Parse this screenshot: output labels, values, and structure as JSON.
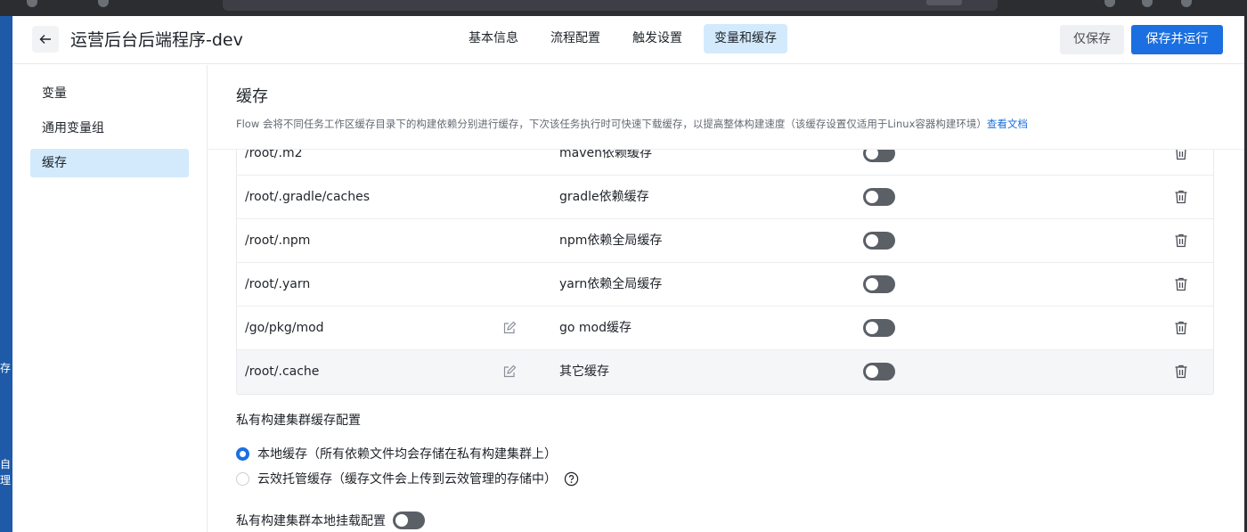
{
  "colors": {
    "accent": "#1b6fe0",
    "active_bg": "#d3eafd",
    "toggle_off": "#5b5f66"
  },
  "desktop": {
    "glyphs": [
      "存",
      "自",
      "理"
    ]
  },
  "header": {
    "title": "运营后台后端程序-dev",
    "tabs": [
      {
        "label": "基本信息",
        "active": false
      },
      {
        "label": "流程配置",
        "active": false
      },
      {
        "label": "触发设置",
        "active": false
      },
      {
        "label": "变量和缓存",
        "active": true
      }
    ],
    "save_only_label": "仅保存",
    "save_run_label": "保存并运行"
  },
  "sidebar": {
    "items": [
      {
        "label": "变量",
        "active": false
      },
      {
        "label": "通用变量组",
        "active": false
      },
      {
        "label": "缓存",
        "active": true
      }
    ]
  },
  "cache": {
    "title": "缓存",
    "description": "Flow 会将不同任务工作区缓存目录下的构建依赖分别进行缓存，下次该任务执行时可快速下载缓存，以提高整体构建速度（该缓存设置仅适用于Linux容器构建环境）",
    "doc_link": "查看文档",
    "rows": [
      {
        "path": "/root/.m2",
        "desc": "maven依赖缓存",
        "enabled": false,
        "editable": false
      },
      {
        "path": "/root/.gradle/caches",
        "desc": "gradle依赖缓存",
        "enabled": false,
        "editable": false
      },
      {
        "path": "/root/.npm",
        "desc": "npm依赖全局缓存",
        "enabled": false,
        "editable": false
      },
      {
        "path": "/root/.yarn",
        "desc": "yarn依赖全局缓存",
        "enabled": false,
        "editable": false
      },
      {
        "path": "/go/pkg/mod",
        "desc": "go mod缓存",
        "enabled": false,
        "editable": true
      },
      {
        "path": "/root/.cache",
        "desc": "其它缓存",
        "enabled": false,
        "editable": true
      }
    ]
  },
  "private_cluster": {
    "cache_title": "私有构建集群缓存配置",
    "options": [
      {
        "label": "本地缓存（所有依赖文件均会存储在私有构建集群上）",
        "checked": true
      },
      {
        "label": "云效托管缓存（缓存文件会上传到云效管理的存储中）",
        "checked": false
      }
    ],
    "mount_label": "私有构建集群本地挂载配置",
    "mount_enabled": false
  }
}
